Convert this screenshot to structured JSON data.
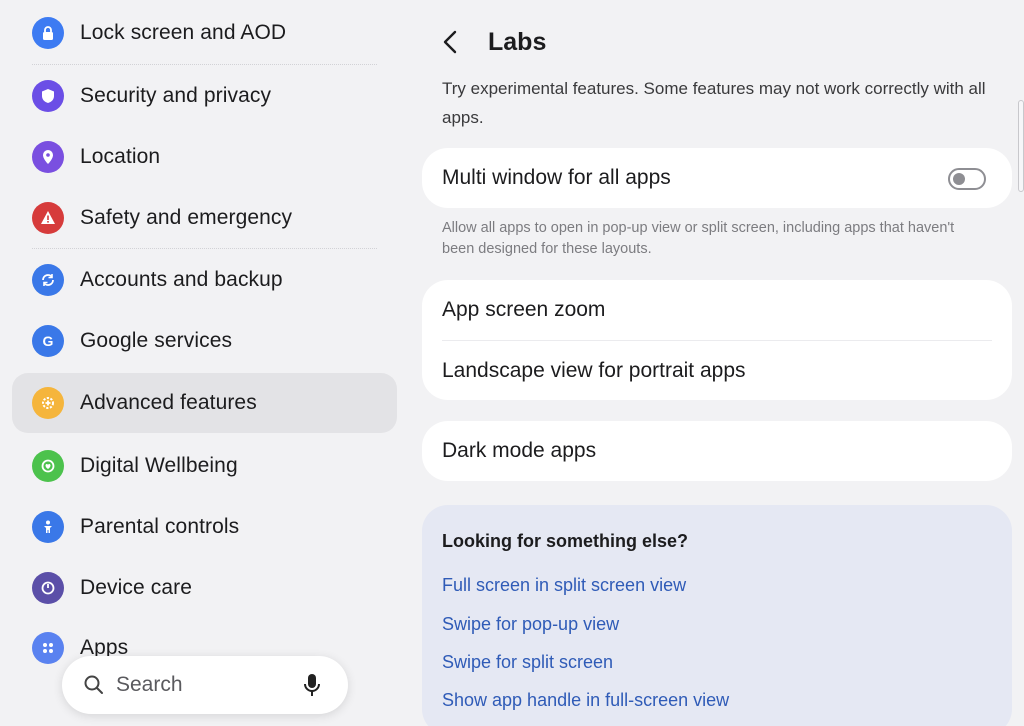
{
  "sidebar": {
    "items": [
      {
        "label": "Lock screen and AOD",
        "icon": "lock-icon",
        "color": "#3d7bf2"
      },
      {
        "label": "Security and privacy",
        "icon": "shield-icon",
        "color": "#6b4ee6"
      },
      {
        "label": "Location",
        "icon": "location-pin-icon",
        "color": "#7a4fe0"
      },
      {
        "label": "Safety and emergency",
        "icon": "alert-icon",
        "color": "#d63b3b"
      },
      {
        "label": "Accounts and backup",
        "icon": "sync-icon",
        "color": "#3a78e8"
      },
      {
        "label": "Google services",
        "icon": "google-icon",
        "color": "#3a78e8"
      },
      {
        "label": "Advanced features",
        "icon": "gear-plus-icon",
        "color": "#f5b53c"
      },
      {
        "label": "Digital Wellbeing",
        "icon": "wellbeing-icon",
        "color": "#4cc24c"
      },
      {
        "label": "Parental controls",
        "icon": "child-icon",
        "color": "#3a78e8"
      },
      {
        "label": "Device care",
        "icon": "device-care-icon",
        "color": "#5b4fa8"
      },
      {
        "label": "Apps",
        "icon": "apps-icon",
        "color": "#5a82f0"
      }
    ],
    "active_index": 6
  },
  "search": {
    "label": "Search"
  },
  "header": {
    "title": "Labs"
  },
  "intro": "Try experimental features. Some features may not work correctly with all apps.",
  "multi_window": {
    "label": "Multi window for all apps",
    "enabled": false,
    "helper": "Allow all apps to open in pop-up view or split screen, including apps that haven't been designed for these layouts."
  },
  "zoom_card": {
    "items": [
      "App screen zoom",
      "Landscape view for portrait apps"
    ]
  },
  "dark_mode": {
    "label": "Dark mode apps"
  },
  "suggestions": {
    "title": "Looking for something else?",
    "links": [
      "Full screen in split screen view",
      "Swipe for pop-up view",
      "Swipe for split screen",
      "Show app handle in full-screen view"
    ]
  },
  "colors": {
    "accent_link": "#2f5bb7",
    "active_bg": "#e3e3e6"
  }
}
